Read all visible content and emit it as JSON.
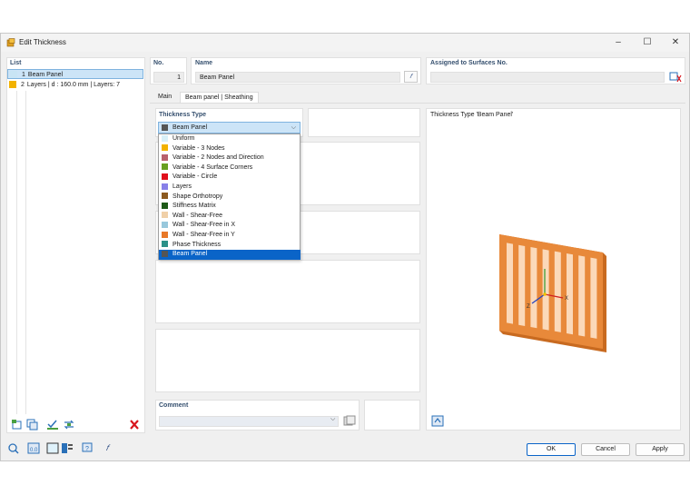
{
  "window": {
    "title": "Edit Thickness"
  },
  "list": {
    "heading": "List",
    "items": [
      {
        "num": "1",
        "label": "Beam Panel",
        "color": "#c8e4f4",
        "selected": true
      },
      {
        "num": "2",
        "label": "Layers | d : 160.0 mm | Layers: 7",
        "color": "#f2b200",
        "selected": false
      }
    ]
  },
  "header": {
    "no_label": "No.",
    "no_value": "1",
    "name_label": "Name",
    "name_value": "Beam Panel",
    "assigned_label": "Assigned to Surfaces No.",
    "assigned_value": ""
  },
  "tabs": [
    {
      "label": "Main",
      "active": false
    },
    {
      "label": "Beam panel | Sheathing",
      "active": true
    }
  ],
  "thickness_type": {
    "label": "Thickness Type",
    "selected": "Beam Panel",
    "selected_color": "#555555",
    "options": [
      {
        "label": "Uniform",
        "color": "#d8f0f8"
      },
      {
        "label": "Variable - 3 Nodes",
        "color": "#f2b200"
      },
      {
        "label": "Variable - 2 Nodes and Direction",
        "color": "#b8606c"
      },
      {
        "label": "Variable - 4 Surface Corners",
        "color": "#68a020"
      },
      {
        "label": "Variable - Circle",
        "color": "#e0101c"
      },
      {
        "label": "Layers",
        "color": "#8880e8"
      },
      {
        "label": "Shape Orthotropy",
        "color": "#8c5a20"
      },
      {
        "label": "Stiffness Matrix",
        "color": "#1e5a18"
      },
      {
        "label": "Wall - Shear-Free",
        "color": "#f0d0a8"
      },
      {
        "label": "Wall - Shear-Free in X",
        "color": "#98c8dc"
      },
      {
        "label": "Wall - Shear-Free in Y",
        "color": "#e87828"
      },
      {
        "label": "Phase Thickness",
        "color": "#2a9088"
      },
      {
        "label": "Beam Panel",
        "color": "#555555"
      }
    ]
  },
  "comment": {
    "label": "Comment",
    "value": ""
  },
  "preview": {
    "caption": "Thickness Type  'Beam Panel'",
    "axis_x": "X",
    "axis_z": "Z",
    "colors": {
      "frame": "#e8893a",
      "slat": "#f4b27a",
      "gap": "#fbd9b9"
    }
  },
  "buttons": {
    "ok": "OK",
    "cancel": "Cancel",
    "apply": "Apply"
  },
  "colors": {
    "accent": "#0a64c8",
    "delete": "#d8141c"
  }
}
